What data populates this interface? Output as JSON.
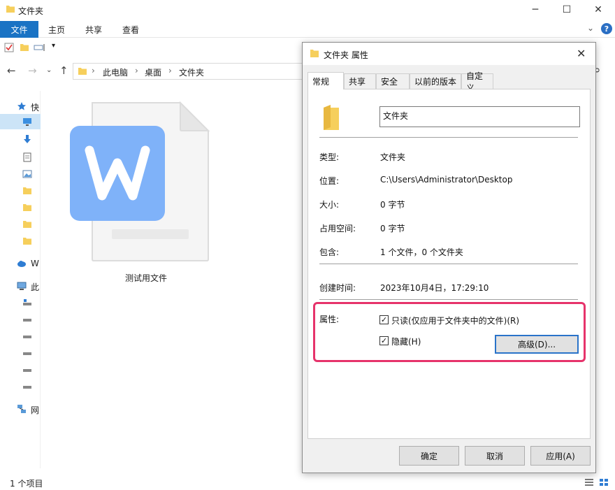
{
  "explorer": {
    "window_title": "文件夹",
    "ribbon": {
      "file_tab": "文件",
      "tabs": [
        "主页",
        "共享",
        "查看"
      ]
    },
    "breadcrumb": [
      "此电脑",
      "桌面",
      "文件夹"
    ],
    "sidebar": {
      "quick_access": "快",
      "wps": "W",
      "this_pc": "此",
      "network": "网"
    },
    "file": {
      "name": "测试用文件",
      "icon": "wps-writer-document-icon"
    },
    "status": "1 个项目"
  },
  "dialog": {
    "title": "文件夹 属性",
    "tabs": [
      "常规",
      "共享",
      "安全",
      "以前的版本",
      "自定义"
    ],
    "active_tab": "常规",
    "name_value": "文件夹",
    "rows": [
      {
        "label": "类型:",
        "value": "文件夹"
      },
      {
        "label": "位置:",
        "value": "C:\\Users\\Administrator\\Desktop"
      },
      {
        "label": "大小:",
        "value": "0 字节"
      },
      {
        "label": "占用空间:",
        "value": "0 字节"
      },
      {
        "label": "包含:",
        "value": "1 个文件，0 个文件夹"
      }
    ],
    "created": {
      "label": "创建时间:",
      "value": "2023年10月4日，17:29:10"
    },
    "attributes": {
      "label": "属性:",
      "readonly": {
        "label": "只读(仅应用于文件夹中的文件)(R)",
        "checked": true
      },
      "hidden": {
        "label": "隐藏(H)",
        "checked": true
      },
      "advanced_button": "高级(D)..."
    },
    "buttons": {
      "ok": "确定",
      "cancel": "取消",
      "apply": "应用(A)"
    }
  },
  "colors": {
    "accent": "#1a73c4",
    "highlight": "#e6336b",
    "folder": "#f6cf5c",
    "wps_blue": "#7fb2f9"
  }
}
